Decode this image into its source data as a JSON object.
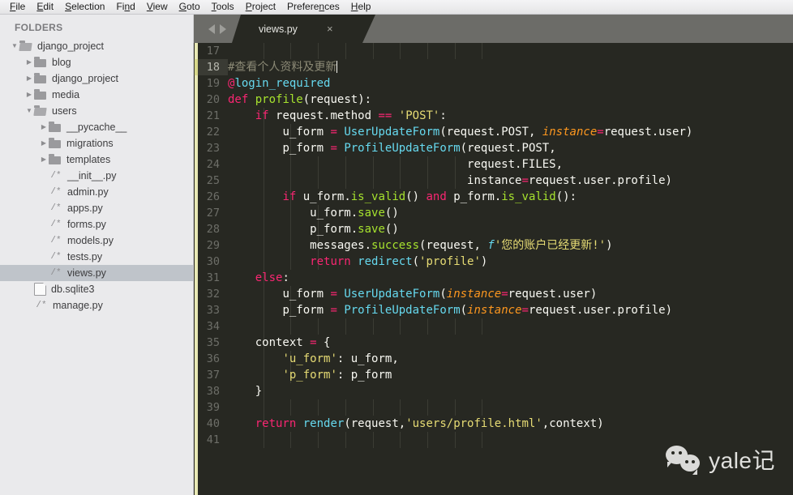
{
  "menubar": {
    "items": [
      {
        "label": "File",
        "mnemonic": "F"
      },
      {
        "label": "Edit",
        "mnemonic": "E"
      },
      {
        "label": "Selection",
        "mnemonic": "S"
      },
      {
        "label": "Find",
        "mnemonic": "n"
      },
      {
        "label": "View",
        "mnemonic": "V"
      },
      {
        "label": "Goto",
        "mnemonic": "G"
      },
      {
        "label": "Tools",
        "mnemonic": "T"
      },
      {
        "label": "Project",
        "mnemonic": "P"
      },
      {
        "label": "Preferences",
        "mnemonic": "n"
      },
      {
        "label": "Help",
        "mnemonic": "H"
      }
    ]
  },
  "sidebar": {
    "title": "FOLDERS",
    "tree": [
      {
        "label": "django_project",
        "type": "folder",
        "depth": 0,
        "state": "expanded",
        "icon": "folder-open-icon",
        "selected": false
      },
      {
        "label": "blog",
        "type": "folder",
        "depth": 1,
        "state": "collapsed",
        "icon": "folder-icon",
        "selected": false
      },
      {
        "label": "django_project",
        "type": "folder",
        "depth": 1,
        "state": "collapsed",
        "icon": "folder-icon",
        "selected": false
      },
      {
        "label": "media",
        "type": "folder",
        "depth": 1,
        "state": "collapsed",
        "icon": "folder-icon",
        "selected": false
      },
      {
        "label": "users",
        "type": "folder",
        "depth": 1,
        "state": "expanded",
        "icon": "folder-open-icon",
        "selected": false
      },
      {
        "label": "__pycache__",
        "type": "folder",
        "depth": 2,
        "state": "collapsed",
        "icon": "folder-icon",
        "selected": false
      },
      {
        "label": "migrations",
        "type": "folder",
        "depth": 2,
        "state": "collapsed",
        "icon": "folder-icon",
        "selected": false
      },
      {
        "label": "templates",
        "type": "folder",
        "depth": 2,
        "state": "collapsed",
        "icon": "folder-icon",
        "selected": false
      },
      {
        "label": "__init__.py",
        "type": "python",
        "depth": 2,
        "state": "leaf",
        "icon": "python-file-icon",
        "selected": false
      },
      {
        "label": "admin.py",
        "type": "python",
        "depth": 2,
        "state": "leaf",
        "icon": "python-file-icon",
        "selected": false
      },
      {
        "label": "apps.py",
        "type": "python",
        "depth": 2,
        "state": "leaf",
        "icon": "python-file-icon",
        "selected": false
      },
      {
        "label": "forms.py",
        "type": "python",
        "depth": 2,
        "state": "leaf",
        "icon": "python-file-icon",
        "selected": false
      },
      {
        "label": "models.py",
        "type": "python",
        "depth": 2,
        "state": "leaf",
        "icon": "python-file-icon",
        "selected": false
      },
      {
        "label": "tests.py",
        "type": "python",
        "depth": 2,
        "state": "leaf",
        "icon": "python-file-icon",
        "selected": false
      },
      {
        "label": "views.py",
        "type": "python",
        "depth": 2,
        "state": "leaf",
        "icon": "python-file-icon",
        "selected": true
      },
      {
        "label": "db.sqlite3",
        "type": "file",
        "depth": 1,
        "state": "leaf",
        "icon": "document-icon",
        "selected": false
      },
      {
        "label": "manage.py",
        "type": "python",
        "depth": 1,
        "state": "leaf",
        "icon": "python-file-icon",
        "selected": false
      }
    ],
    "icons": {
      "python": "/*",
      "expanded_arrow": "▼",
      "collapsed_arrow": "▶"
    }
  },
  "tabbar": {
    "nav_back_icon": "arrow-left-icon",
    "nav_forward_icon": "arrow-right-icon",
    "tabs": [
      {
        "label": "views.py",
        "active": true,
        "close_icon": "×"
      }
    ]
  },
  "editor": {
    "active_line": 18,
    "first_visible_line": 17,
    "last_visible_line": 41,
    "cursor_line": 18,
    "colors": {
      "background": "#272822",
      "gutter_text": "#6d6e68",
      "active_line_marker": "#d8d88a",
      "modified_strip": "#e8e8b4",
      "keyword": "#f92672",
      "string": "#e6db74",
      "function": "#66d9ef",
      "parameter": "#fd971f",
      "comment": "#8b8975",
      "plain": "#f8f8f2"
    },
    "lines": [
      {
        "num": 17,
        "text": ""
      },
      {
        "num": 18,
        "text": "#查看个人资料及更新"
      },
      {
        "num": 19,
        "text": "@login_required"
      },
      {
        "num": 20,
        "text": "def profile(request):"
      },
      {
        "num": 21,
        "text": "    if request.method == 'POST':"
      },
      {
        "num": 22,
        "text": "        u_form = UserUpdateForm(request.POST, instance=request.user)"
      },
      {
        "num": 23,
        "text": "        p_form = ProfileUpdateForm(request.POST,"
      },
      {
        "num": 24,
        "text": "                                   request.FILES,"
      },
      {
        "num": 25,
        "text": "                                   instance=request.user.profile)"
      },
      {
        "num": 26,
        "text": "        if u_form.is_valid() and p_form.is_valid():"
      },
      {
        "num": 27,
        "text": "            u_form.save()"
      },
      {
        "num": 28,
        "text": "            p_form.save()"
      },
      {
        "num": 29,
        "text": "            messages.success(request, f'您的账户已经更新!')"
      },
      {
        "num": 30,
        "text": "            return redirect('profile')"
      },
      {
        "num": 31,
        "text": "    else:"
      },
      {
        "num": 32,
        "text": "        u_form = UserUpdateForm(instance=request.user)"
      },
      {
        "num": 33,
        "text": "        p_form = ProfileUpdateForm(instance=request.user.profile)"
      },
      {
        "num": 34,
        "text": ""
      },
      {
        "num": 35,
        "text": "    context = {"
      },
      {
        "num": 36,
        "text": "        'u_form': u_form,"
      },
      {
        "num": 37,
        "text": "        'p_form': p_form"
      },
      {
        "num": 38,
        "text": "    }"
      },
      {
        "num": 39,
        "text": ""
      },
      {
        "num": 40,
        "text": "    return render(request,'users/profile.html',context)"
      },
      {
        "num": 41,
        "text": ""
      }
    ]
  },
  "watermark": {
    "text": "yale记",
    "icon": "wechat-icon"
  }
}
